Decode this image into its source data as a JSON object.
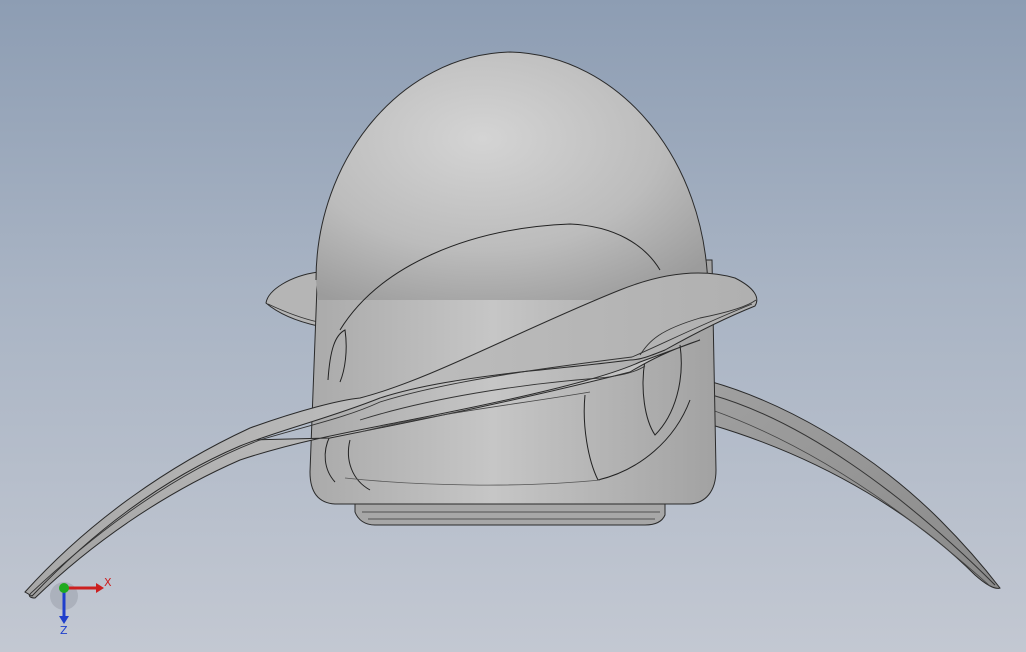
{
  "viewport": {
    "background_top": "#8d9db3",
    "background_bottom": "#c3c8d2",
    "model": "propeller",
    "shading": "shaded-with-edges"
  },
  "triad": {
    "x_label": "X",
    "z_label": "Z",
    "x_color": "#cc1f1f",
    "y_color": "#1faa1f",
    "z_color": "#1f3fcc"
  }
}
